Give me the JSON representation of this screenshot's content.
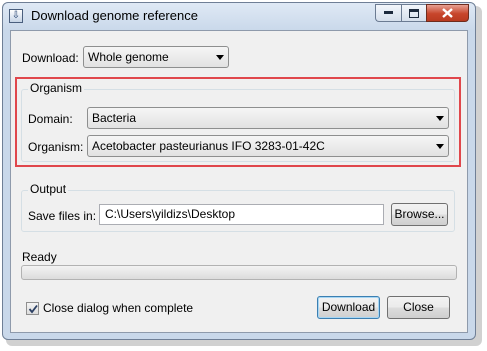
{
  "window": {
    "title": "Download genome reference",
    "icon": "download-app-icon"
  },
  "download": {
    "label": "Download:",
    "selected": "Whole genome"
  },
  "organism_group": {
    "legend": "Organism",
    "domain_label": "Domain:",
    "domain_selected": "Bacteria",
    "organism_label": "Organism:",
    "organism_selected": "Acetobacter pasteurianus IFO 3283-01-42C",
    "highlight_color": "#e0474c"
  },
  "output_group": {
    "legend": "Output",
    "save_label": "Save files in:",
    "save_path": "C:\\Users\\yildizs\\Desktop",
    "browse_button": "Browse..."
  },
  "status": {
    "text": "Ready",
    "progress": 0
  },
  "footer": {
    "checkbox_label": "Close dialog when complete",
    "checkbox_checked": true,
    "download_button": "Download",
    "close_button": "Close"
  }
}
